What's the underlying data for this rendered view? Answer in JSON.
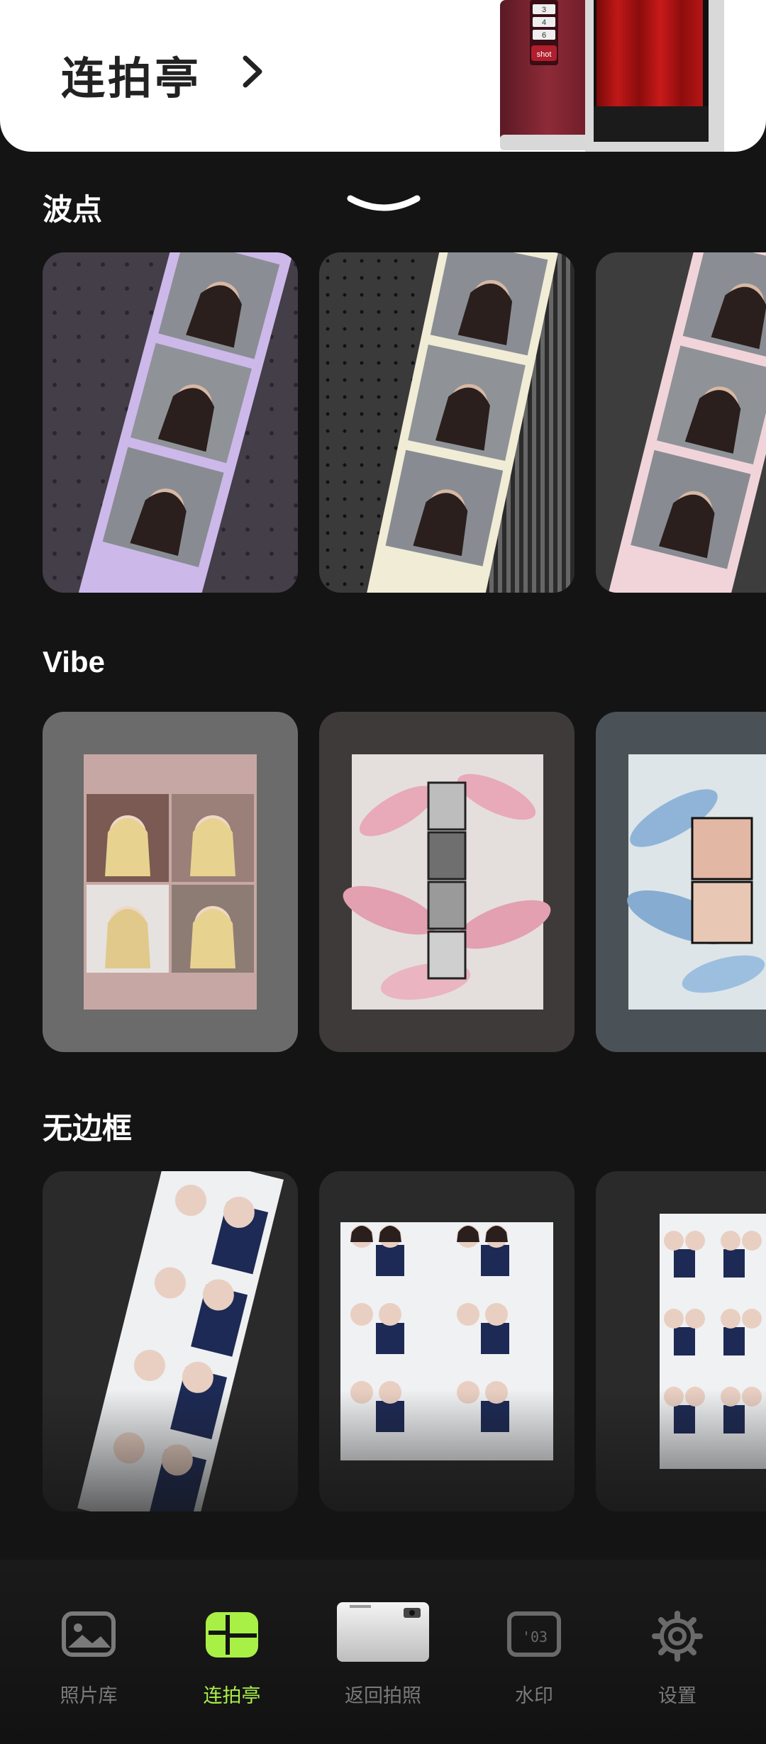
{
  "header": {
    "title": "连拍亭",
    "booth_buttons": [
      "3",
      "4",
      "6"
    ],
    "booth_brand": "shot"
  },
  "sections": [
    {
      "title": "波点"
    },
    {
      "title": "Vibe"
    },
    {
      "title": "无边框"
    }
  ],
  "nav": {
    "items": [
      {
        "label": "照片库",
        "icon": "photo-library-icon",
        "active": false
      },
      {
        "label": "连拍亭",
        "icon": "photobooth-layout-icon",
        "active": true
      },
      {
        "label": "返回拍照",
        "icon": "camera-icon",
        "active": false
      },
      {
        "label": "水印",
        "icon": "watermark-icon",
        "active": false
      },
      {
        "label": "设置",
        "icon": "gear-icon",
        "active": false
      }
    ],
    "watermark_text": "'03"
  },
  "colors": {
    "accent": "#a8f046",
    "background": "#141414",
    "card": "#2a2a2a"
  }
}
